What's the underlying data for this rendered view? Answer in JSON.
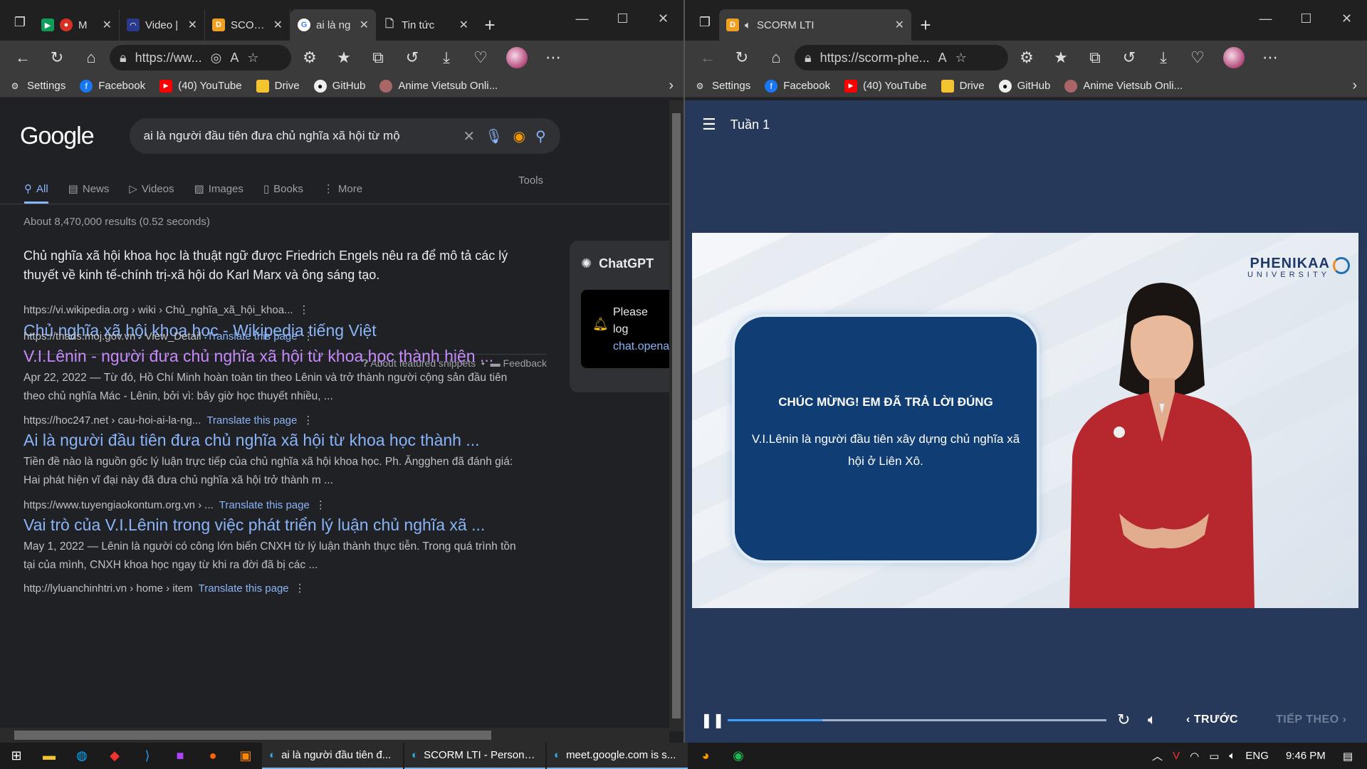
{
  "left_window": {
    "tabs": [
      {
        "title": "M",
        "active": false,
        "favicon": "meet-icon"
      },
      {
        "title": "Video |",
        "active": false,
        "favicon": "video-icon"
      },
      {
        "title": "SCORM",
        "active": false,
        "favicon": "scorm-icon"
      },
      {
        "title": "ai là ng",
        "active": true,
        "favicon": "google-icon"
      },
      {
        "title": "Tin tức",
        "active": false,
        "favicon": "page-icon"
      }
    ],
    "url": "https://ww...",
    "bookmarks": [
      "Settings",
      "Facebook",
      "(40) YouTube",
      "Drive",
      "GitHub",
      "Anime Vietsub Onli..."
    ]
  },
  "google": {
    "logo": "Google",
    "query": "ai là người đầu tiên đưa chủ nghĩa xã hội từ mộ",
    "tabs": [
      "All",
      "News",
      "Videos",
      "Images",
      "Books",
      "More"
    ],
    "tools": "Tools",
    "stats": "About 8,470,000 results (0.52 seconds)",
    "featured_snippet": "Chủ nghĩa xã hội khoa học là thuật ngữ được Friedrich Engels nêu ra để mô tả các lý thuyết về kinh tế-chính trị-xã hội do Karl Marx và ông sáng tạo.",
    "featured_cite": "https://vi.wikipedia.org › wiki › Chủ_nghĩa_xã_hội_khoa...",
    "featured_title": "Chủ nghĩa xã hội khoa học - Wikipedia tiếng Việt",
    "about_snippets": "About featured snippets",
    "feedback": "Feedback",
    "translate_label": "Translate this page",
    "results": [
      {
        "cite": "https://thads.moj.gov.vn › View_Detail",
        "title": "V.I.Lênin - người đưa chủ nghĩa xã hội từ khoa học thành hiện ...",
        "desc": "Apr 22, 2022 — Từ đó, Hồ Chí Minh hoàn toàn tin theo Lênin và trở thành người cộng sản đầu tiên theo chủ nghĩa Mác - Lênin, bởi vì: bây giờ học thuyết nhiều, ..."
      },
      {
        "cite": "https://hoc247.net › cau-hoi-ai-la-ng...",
        "title": "Ai là người đầu tiên đưa chủ nghĩa xã hội từ khoa học thành ...",
        "desc": "Tiền đề nào là nguồn gốc lý luận trực tiếp của chủ nghĩa xã hội khoa học. Ph. Ăngghen đã đánh giá: Hai phát hiện vĩ đại này đã đưa chủ nghĩa xã hội trở thành m ..."
      },
      {
        "cite": "https://www.tuyengiaokontum.org.vn › ...",
        "title": "Vai trò của V.I.Lênin trong việc phát triển lý luận chủ nghĩa xã ...",
        "desc": "May 1, 2022 — Lênin là người có công lớn biến CNXH từ lý luận thành thực tiễn. Trong quá trình tồn tại của mình, CNXH khoa học ngay từ khi ra đời đã bị các ..."
      },
      {
        "cite": "http://lyluanchinhtri.vn › home › item",
        "title": "",
        "desc": ""
      }
    ],
    "chatgpt": {
      "title": "ChatGPT",
      "line1": "Please log",
      "line2": "chat.opena"
    }
  },
  "right_window": {
    "tab_title": "SCORM LTI",
    "url": "https://scorm-phe...",
    "bookmarks": [
      "Settings",
      "Facebook",
      "(40) YouTube",
      "Drive",
      "GitHub",
      "Anime Vietsub Onli..."
    ]
  },
  "scorm": {
    "week": "Tuần 1",
    "logo_name": "PHENIKAA",
    "logo_sub": "UNIVERSITY",
    "card_title": "CHÚC MỪNG! EM ĐÃ TRẢ LỜI ĐÚNG",
    "card_body": "V.I.Lênin là người đầu tiên xây dựng chủ nghĩa xã hội ở Liên Xô.",
    "progress_fraction": 0.25,
    "prev_label": "TRƯỚC",
    "next_label": "TIẾP THEO"
  },
  "taskbar": {
    "apps": [
      "ai là người đầu tiên đ...",
      "SCORM LTI - Personal ...",
      "meet.google.com is s..."
    ],
    "language": "ENG",
    "time": "9:46 PM"
  }
}
